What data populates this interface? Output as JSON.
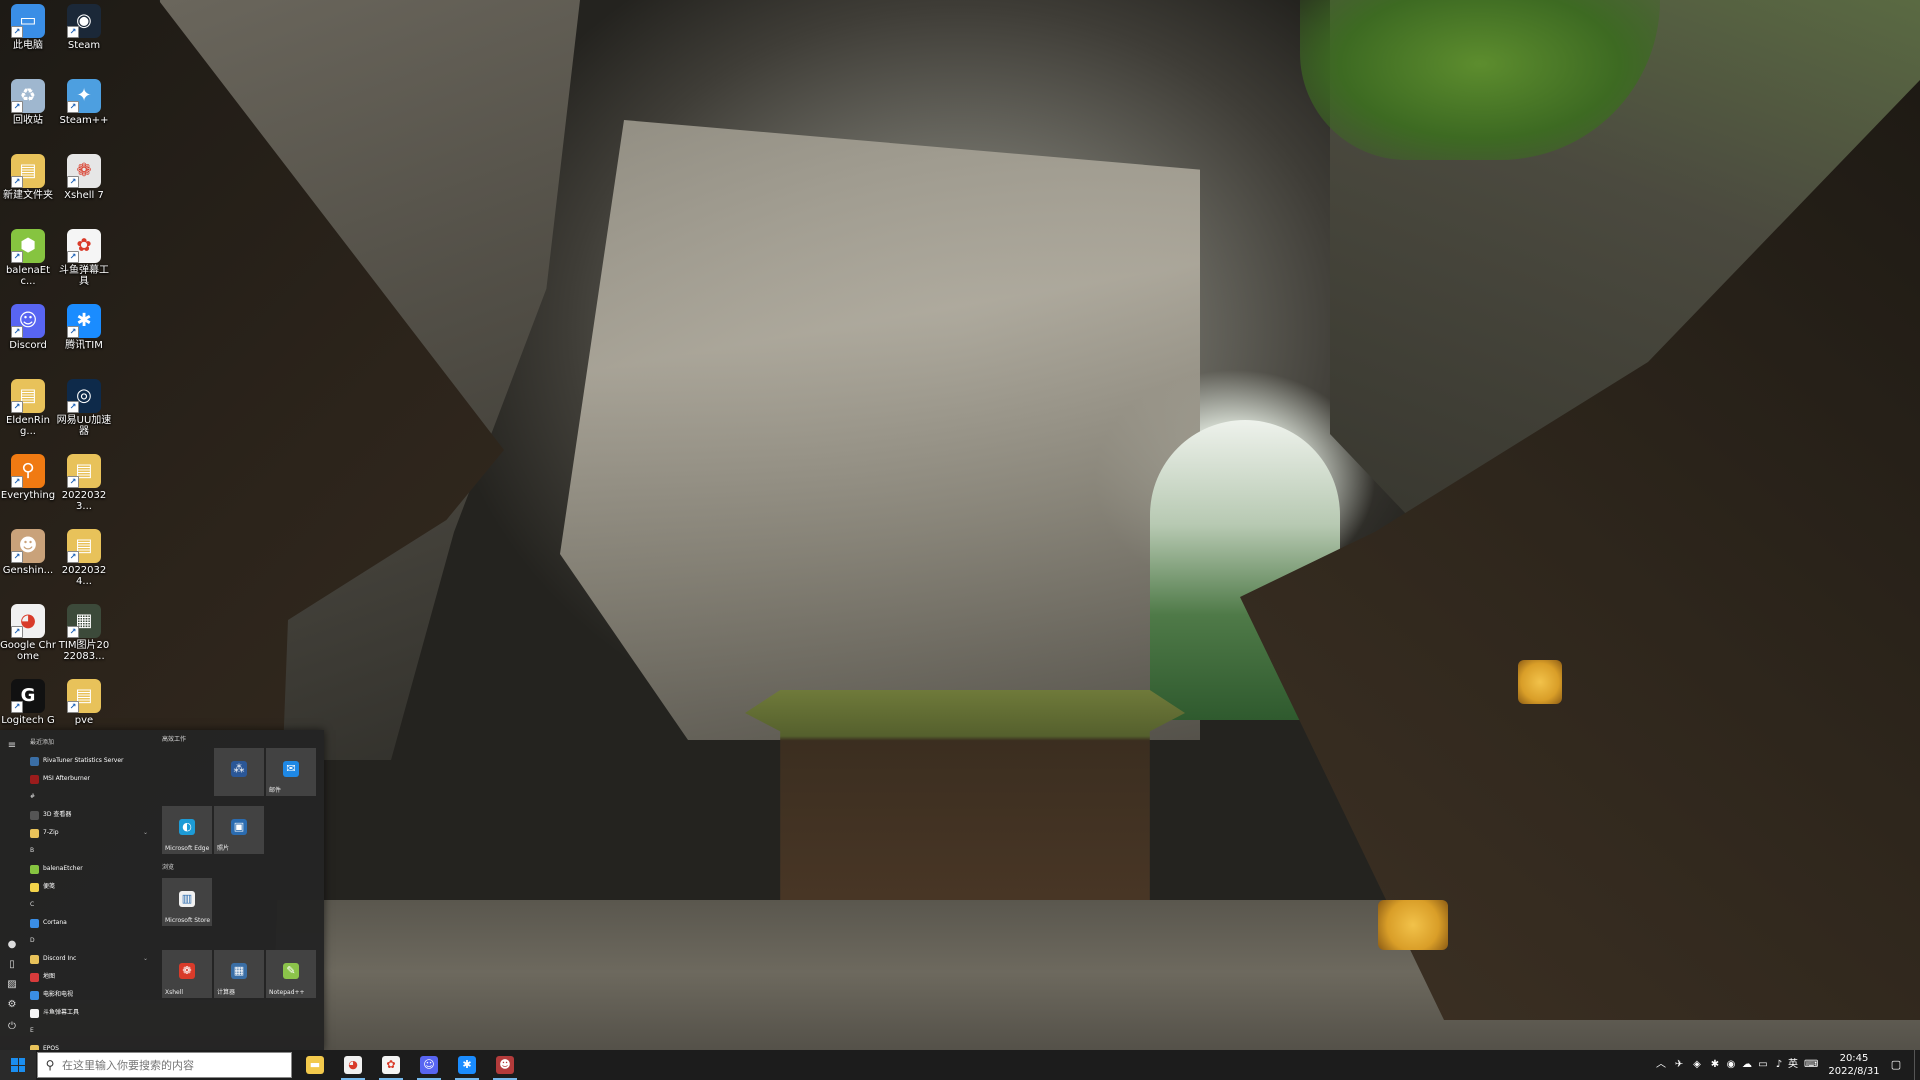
{
  "desktop": {
    "icons": [
      {
        "label": "此电脑",
        "icon": "computer-icon",
        "color": "#3a8ee6",
        "glyph": "▭"
      },
      {
        "label": "Steam",
        "icon": "steam-icon",
        "color": "#1b2838",
        "glyph": "◉"
      },
      {
        "label": "回收站",
        "icon": "recycle-bin-icon",
        "color": "#9fb7cf",
        "glyph": "♻"
      },
      {
        "label": "Steam++",
        "icon": "steam-plus-icon",
        "color": "#4d9fe0",
        "glyph": "✦"
      },
      {
        "label": "新建文件夹",
        "icon": "folder-icon",
        "color": "#e8c25a",
        "glyph": "▤"
      },
      {
        "label": "Xshell 7",
        "icon": "xshell-icon",
        "color": "#e6e6e6",
        "glyph": "❁"
      },
      {
        "label": "balenaEtc...",
        "icon": "balena-etcher-icon",
        "color": "#86c440",
        "glyph": "⬢"
      },
      {
        "label": "斗鱼弹幕工具",
        "icon": "douyu-tool-icon",
        "color": "#f5f5f5",
        "glyph": "✿"
      },
      {
        "label": "Discord",
        "icon": "discord-icon",
        "color": "#5865f2",
        "glyph": "☺"
      },
      {
        "label": "腾讯TIM",
        "icon": "tencent-tim-icon",
        "color": "#1a8cff",
        "glyph": "✱"
      },
      {
        "label": "EldenRing...",
        "icon": "folder-icon",
        "color": "#e8c25a",
        "glyph": "▤"
      },
      {
        "label": "网易UU加速器",
        "icon": "uu-accelerator-icon",
        "color": "#0e2a4a",
        "glyph": "◎"
      },
      {
        "label": "Everything",
        "icon": "everything-icon",
        "color": "#f07a12",
        "glyph": "⚲"
      },
      {
        "label": "20220323...",
        "icon": "folder-icon",
        "color": "#e8c25a",
        "glyph": "▤"
      },
      {
        "label": "Genshin...",
        "icon": "genshin-icon",
        "color": "#c9a27a",
        "glyph": "☻"
      },
      {
        "label": "20220324...",
        "icon": "folder-icon",
        "color": "#e8c25a",
        "glyph": "▤"
      },
      {
        "label": "Google Chrome",
        "icon": "chrome-icon",
        "color": "#f1f1f1",
        "glyph": "◕"
      },
      {
        "label": "TIM图片2022083...",
        "icon": "image-file-icon",
        "color": "#3c4a3a",
        "glyph": "▦"
      },
      {
        "label": "Logitech G",
        "icon": "logitech-g-icon",
        "color": "#111111",
        "glyph": "G"
      },
      {
        "label": "pve",
        "icon": "file-icon",
        "color": "#e8c25a",
        "glyph": "▤"
      }
    ]
  },
  "start_menu": {
    "recent_header": "最近添加",
    "recent_apps": [
      {
        "label": "RivaTuner Statistics Server",
        "icon": "rivatuner-icon",
        "color": "#3a6ea5"
      },
      {
        "label": "MSI Afterburner",
        "icon": "msi-afterburner-icon",
        "color": "#9b1c1c"
      }
    ],
    "sections": [
      {
        "letter": "#",
        "apps": [
          {
            "label": "3D 查看器",
            "icon": "3d-viewer-icon",
            "color": "#555555"
          },
          {
            "label": "7-Zip",
            "icon": "folder-icon",
            "color": "#e8c25a",
            "chevron": "⌄"
          }
        ]
      },
      {
        "letter": "B",
        "apps": [
          {
            "label": "balenaEtcher",
            "icon": "balena-etcher-icon",
            "color": "#86c440"
          },
          {
            "label": "便笺",
            "icon": "sticky-notes-icon",
            "color": "#f3d34a"
          }
        ]
      },
      {
        "letter": "C",
        "apps": [
          {
            "label": "Cortana",
            "icon": "cortana-icon",
            "color": "#3a8ee6"
          }
        ]
      },
      {
        "letter": "D",
        "apps": [
          {
            "label": "Discord Inc",
            "icon": "folder-icon",
            "color": "#e8c25a",
            "chevron": "⌄"
          },
          {
            "label": "地图",
            "icon": "maps-icon",
            "color": "#d83b3b"
          },
          {
            "label": "电影和电视",
            "icon": "movies-icon",
            "color": "#3a8ee6"
          },
          {
            "label": "斗鱼弹幕工具",
            "icon": "douyu-tool-icon",
            "color": "#f5f5f5"
          }
        ]
      },
      {
        "letter": "E",
        "apps": [
          {
            "label": "EPOS",
            "icon": "folder-icon",
            "color": "#e8c25a"
          }
        ]
      }
    ],
    "tile_groups": [
      {
        "header": "高效工作"
      },
      {
        "header": "浏览"
      }
    ],
    "tiles": [
      {
        "label": "",
        "icon": "office-apps-icon",
        "color": "#2b5797",
        "glyph": "⁂"
      },
      {
        "label": "邮件",
        "icon": "mail-icon",
        "color": "#1e88e5",
        "glyph": "✉"
      },
      {
        "label": "Microsoft Edge",
        "icon": "edge-icon",
        "color": "#1d9bd6",
        "glyph": "◐"
      },
      {
        "label": "照片",
        "icon": "photos-icon",
        "color": "#2b6cb0",
        "glyph": "▣"
      },
      {
        "label": "Microsoft Store",
        "icon": "store-icon",
        "color": "#f1f1f1",
        "glyph": "▥"
      },
      {
        "label": "Xshell",
        "icon": "xshell-icon",
        "color": "#d93b2a",
        "glyph": "❁"
      },
      {
        "label": "计算器",
        "icon": "calculator-icon",
        "color": "#3a6ea5",
        "glyph": "▦"
      },
      {
        "label": "Notepad++",
        "icon": "notepad-plus-icon",
        "color": "#8bc34a",
        "glyph": "✎"
      }
    ],
    "rail": [
      {
        "icon": "hamburger-menu-icon",
        "glyph": "≡"
      },
      {
        "icon": "user-avatar-icon",
        "glyph": "●"
      },
      {
        "icon": "document-icon",
        "glyph": "▯"
      },
      {
        "icon": "pictures-icon",
        "glyph": "▨"
      },
      {
        "icon": "settings-gear-icon",
        "glyph": "⚙"
      },
      {
        "icon": "power-icon",
        "glyph": "⏻"
      }
    ]
  },
  "taskbar": {
    "search_placeholder": "在这里输入你要搜索的内容",
    "apps": [
      {
        "icon": "file-explorer-icon",
        "color": "#f2c94c",
        "glyph": "▬",
        "open": false
      },
      {
        "icon": "chrome-icon",
        "color": "#f1f1f1",
        "glyph": "◕",
        "open": true
      },
      {
        "icon": "douyu-tool-icon",
        "color": "#f5f5f5",
        "glyph": "✿",
        "open": true
      },
      {
        "icon": "discord-icon",
        "color": "#5865f2",
        "glyph": "☺",
        "open": true
      },
      {
        "icon": "tencent-tim-icon",
        "color": "#1a8cff",
        "glyph": "✱",
        "open": true
      },
      {
        "icon": "game-app-icon",
        "color": "#b33b3b",
        "glyph": "☻",
        "open": true
      }
    ],
    "tray": [
      {
        "icon": "chevron-up-icon",
        "glyph": "︿"
      },
      {
        "icon": "tray-app-icon",
        "glyph": "✈"
      },
      {
        "icon": "tray-app-icon",
        "glyph": "◈"
      },
      {
        "icon": "tray-app-icon",
        "glyph": "✱"
      },
      {
        "icon": "tray-app-icon",
        "glyph": "◉"
      },
      {
        "icon": "onedrive-icon",
        "glyph": "☁"
      },
      {
        "icon": "network-icon",
        "glyph": "▭"
      },
      {
        "icon": "volume-icon",
        "glyph": "♪"
      },
      {
        "icon": "ime-mode",
        "glyph": "英"
      },
      {
        "icon": "ime-keyboard-icon",
        "glyph": "⌨"
      }
    ],
    "time": "20:45",
    "date": "2022/8/31",
    "notification_glyph": "▢"
  },
  "colors": {
    "taskbar_bg": "#1c1c1c",
    "start_menu_bg": "#242424",
    "accent": "#1b8ef0"
  }
}
